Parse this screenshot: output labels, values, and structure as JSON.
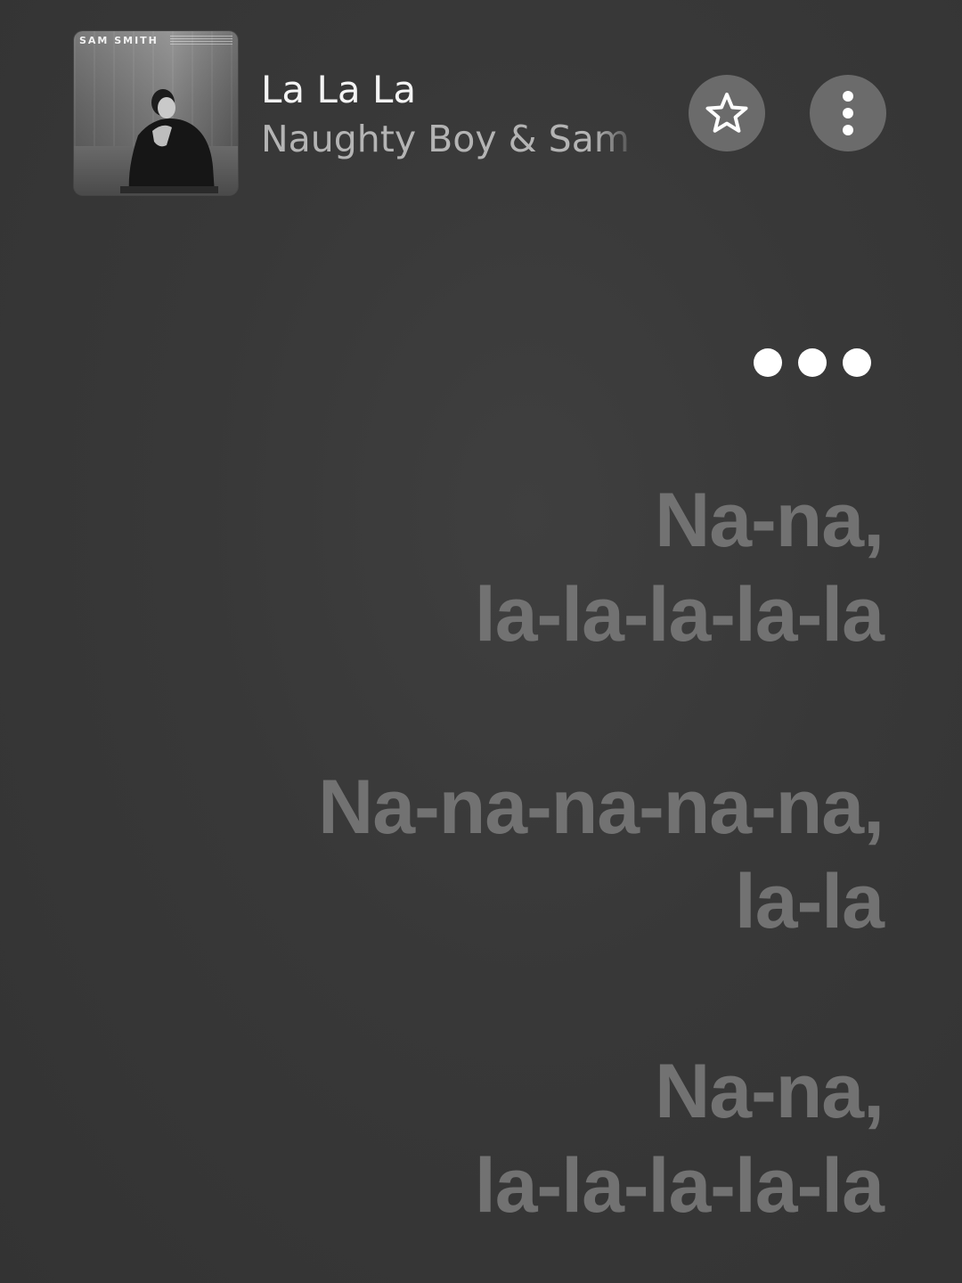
{
  "now_playing": {
    "title": "La La La",
    "artist": "Naughty Boy & Sam Smith",
    "album_art": {
      "artist_text": "SAM SMITH",
      "description": "black and white album cover"
    }
  },
  "controls": {
    "favorite_icon": "star-outline-icon",
    "more_icon": "vertical-ellipsis-icon"
  },
  "lyrics": [
    {
      "lines": [
        "Na-na,",
        "la-la-la-la-la"
      ]
    },
    {
      "lines": [
        "Na-na-na-na-na,",
        "la-la"
      ]
    },
    {
      "lines": [
        "Na-na,",
        "la-la-la-la-la"
      ]
    }
  ],
  "colors": {
    "title": "#f4f4f4",
    "artist": "#b4b4b4",
    "lyric_inactive": "#727272",
    "button_bg": "#6b6b6b"
  }
}
